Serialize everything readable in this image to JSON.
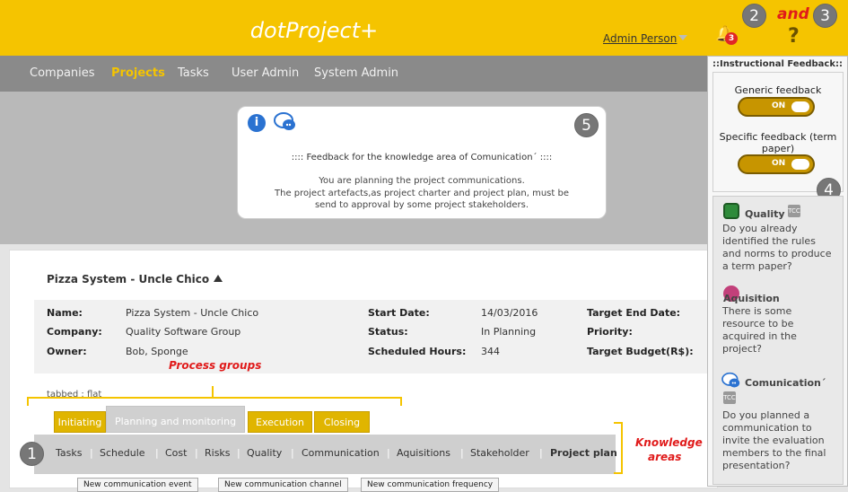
{
  "app": {
    "brand": "dotProject+",
    "user": "Admin Person"
  },
  "header": {
    "bell_count": "3",
    "help_symbol": "?",
    "and_label": "and"
  },
  "markers": {
    "m1": "1",
    "m2": "2",
    "m3": "3",
    "m4": "4",
    "m5": "5"
  },
  "nav": {
    "items": [
      "Companies",
      "Projects",
      "Tasks",
      "User Admin",
      "System Admin"
    ],
    "active": "Projects"
  },
  "feedback": {
    "title": ":::: Feedback for the knowledge area of Comunication´ ::::",
    "line1": "You are planning the project communications.",
    "line2": "The project artefacts,as project charter and project plan, must be",
    "line3": "send to approval by some project stakeholders."
  },
  "project": {
    "title": "Pizza System - Uncle Chico",
    "fields": {
      "name_label": "Name:",
      "name_value": "Pizza System - Uncle Chico",
      "company_label": "Company:",
      "company_value": "Quality Software Group",
      "owner_label": "Owner:",
      "owner_value": "Bob, Sponge",
      "start_label": "Start Date:",
      "start_value": "14/03/2016",
      "status_label": "Status:",
      "status_value": "In Planning",
      "hours_label": "Scheduled Hours:",
      "hours_value": "344",
      "target_end_label": "Target End Date:",
      "priority_label": "Priority:",
      "budget_label": "Target Budget(R$):"
    }
  },
  "annotations": {
    "process_groups": "Process groups",
    "knowledge": "Knowledge",
    "areas": "areas"
  },
  "view_mode": "tabbed : flat",
  "tabs": [
    "Initiating",
    "Planning and monitoring",
    "Execution",
    "Closing"
  ],
  "knowledge_areas": [
    "Tasks",
    "Schedule",
    "Cost",
    "Risks",
    "Quality",
    "Communication",
    "Aquisitions",
    "Stakeholder",
    "Project plan"
  ],
  "separator": "|",
  "buttons": [
    "New communication event",
    "New communication channel",
    "New communication frequency"
  ],
  "sidebar": {
    "heading": "::Instructional Feedback::",
    "generic_label": "Generic feedback",
    "generic_state": "ON",
    "specific_label_1": "Specific feedback (term",
    "specific_label_2": "paper)",
    "specific_state": "ON",
    "tcc": "TCC",
    "quality_title": "Quality",
    "quality_text": [
      "Do you already",
      "identified the rules",
      "and norms to produce",
      "a term paper?"
    ],
    "acq_title": "Aquisition",
    "acq_text": [
      "There is some",
      "resource to be",
      "acquired in the",
      "project?"
    ],
    "com_title": "Comunication´",
    "com_text": [
      "Do you planned a",
      "communication to",
      "invite the evaluation",
      "members to the final",
      "presentation?"
    ]
  },
  "colors": {
    "accent": "#f5c400",
    "nav": "#8a8a8a",
    "annotation": "#e01a1a"
  }
}
